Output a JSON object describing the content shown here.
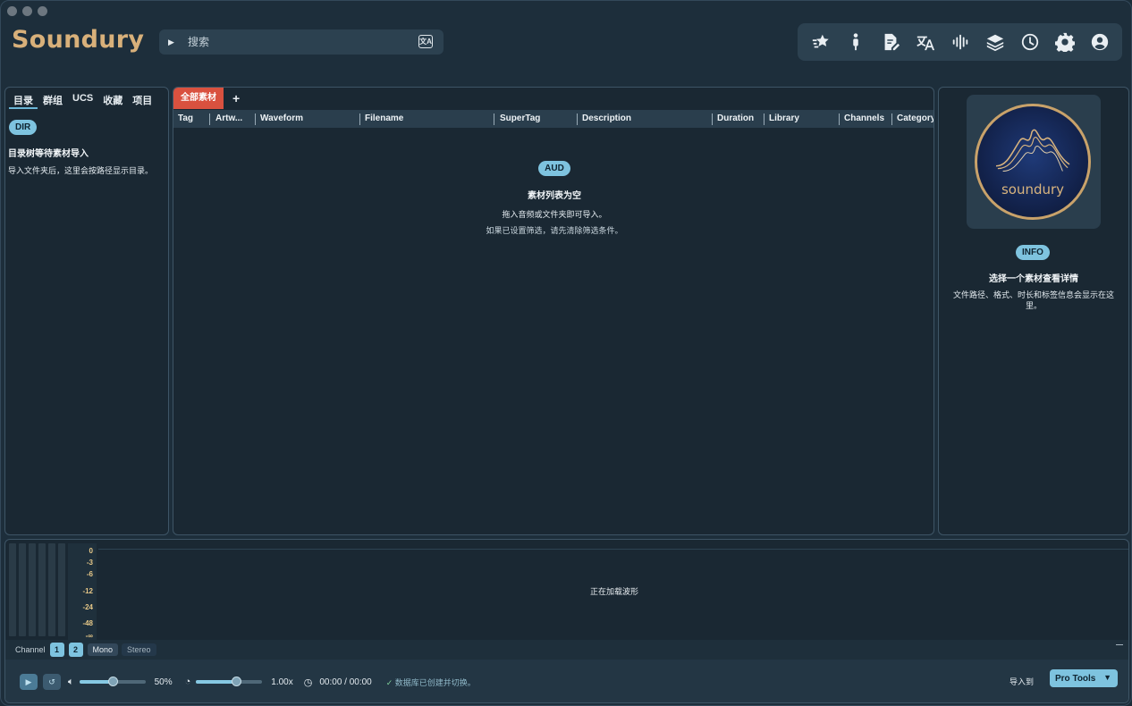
{
  "app": {
    "brand": "Soundury"
  },
  "search": {
    "placeholder": "搜索"
  },
  "toolbar": {
    "icons": [
      "favorites-star-icon",
      "pin-icon",
      "edit-document-icon",
      "translate-icon",
      "waveform-icon",
      "layers-icon",
      "history-icon",
      "settings-gear-icon",
      "account-icon"
    ]
  },
  "left_panel": {
    "tabs": [
      "目录",
      "群组",
      "UCS",
      "收藏",
      "项目"
    ],
    "badge": "DIR",
    "title": "目录树等待素材导入",
    "description": "导入文件夹后，这里会按路径显示目录。"
  },
  "mid_panel": {
    "tab_active": "全部素材",
    "add_tab": "+",
    "columns": [
      "Tag",
      "Artw...",
      "Waveform",
      "Filename",
      "SuperTag",
      "Description",
      "Duration",
      "Library",
      "Channels",
      "Category"
    ],
    "empty": {
      "badge": "AUD",
      "title": "素材列表为空",
      "line1": "拖入音频或文件夹即可导入。",
      "line2": "如果已设置筛选，请先清除筛选条件。"
    }
  },
  "right_panel": {
    "logo_text": "soundury",
    "badge": "INFO",
    "title": "选择一个素材查看详情",
    "description": "文件路径、格式、时长和标签信息会显示在这里。"
  },
  "meter": {
    "scale": [
      "0",
      "-3",
      "-6",
      "-12",
      "-24",
      "-48",
      "-∞"
    ]
  },
  "waveform": {
    "message": "正在加载波形"
  },
  "channel": {
    "label": "Channel",
    "buttons": [
      "1",
      "2"
    ],
    "modes": [
      "Mono",
      "Stereo"
    ],
    "active_mode": "Mono"
  },
  "transport": {
    "volume": "50%",
    "volume_fraction": 0.5,
    "speed": "1.00x",
    "speed_fraction": 0.6,
    "time": "00:00 / 00:00",
    "status": "数据库已创建并切换。",
    "import_label": "导入到",
    "import_target": "Pro Tools"
  },
  "colors": {
    "background": "#1d2e3b",
    "accent": "#7ec3df",
    "brand": "#d8b07a",
    "active_tab": "#d9513f"
  }
}
